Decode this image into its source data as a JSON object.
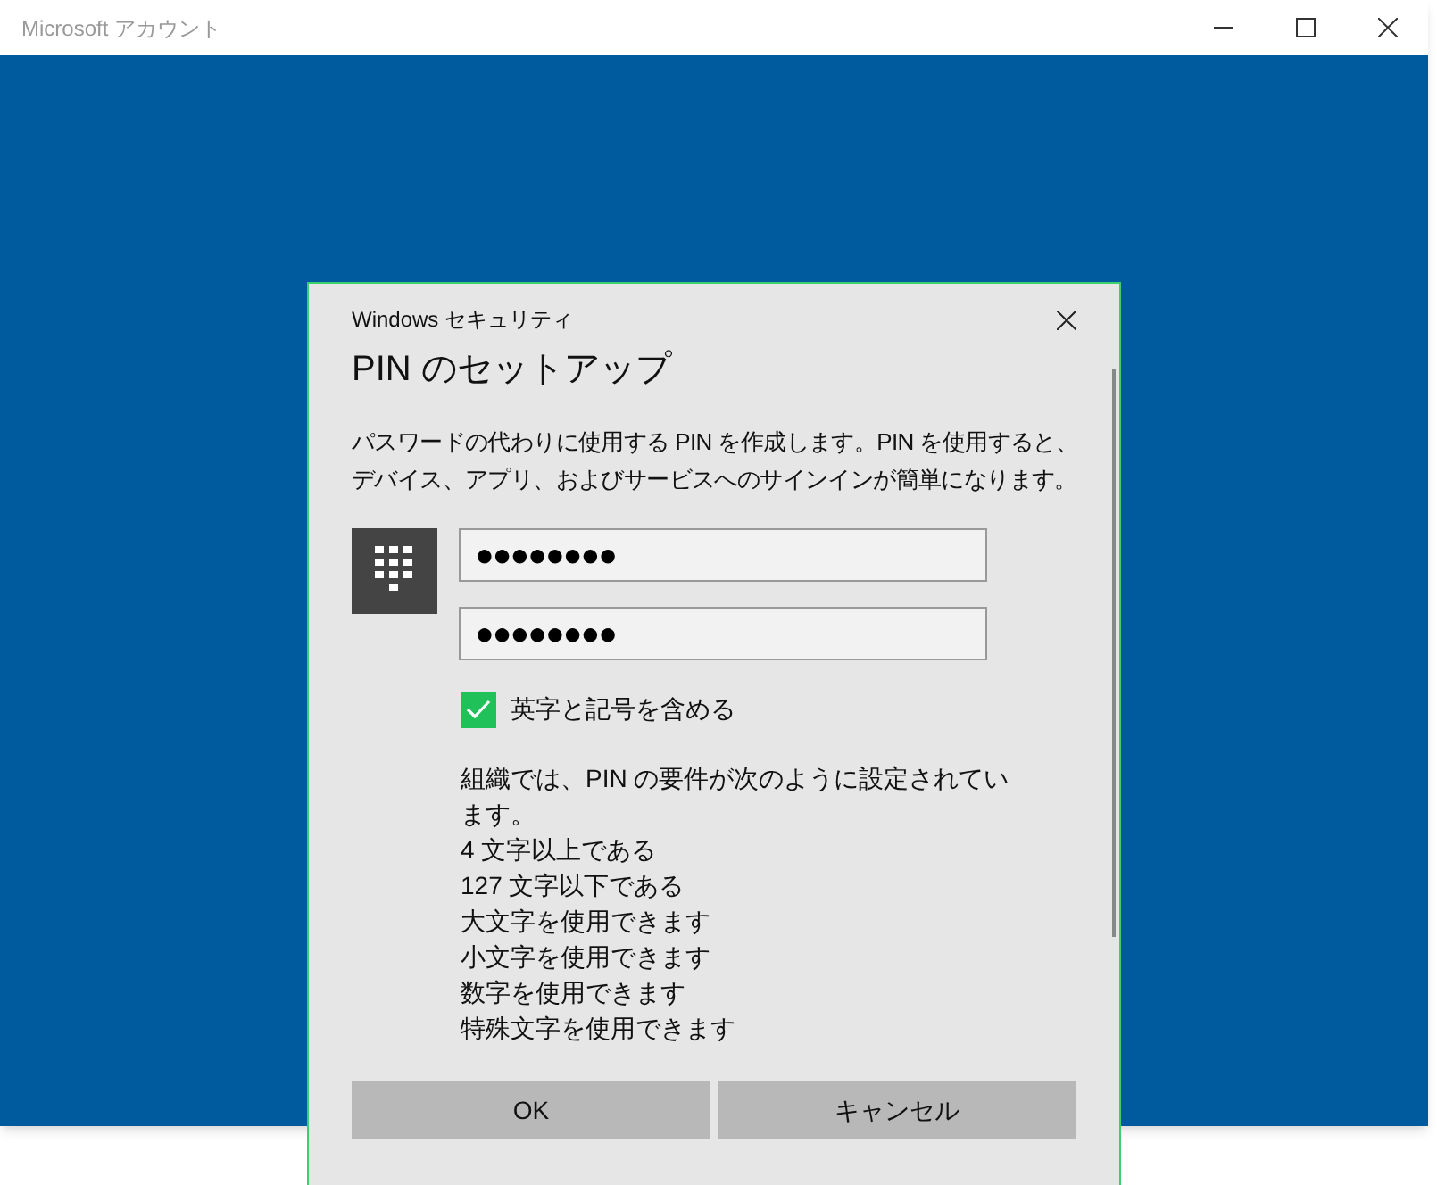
{
  "window": {
    "title": "Microsoft アカウント"
  },
  "dialog": {
    "caption": "Windows セキュリティ",
    "heading": "PIN のセットアップ",
    "description": "パスワードの代わりに使用する PIN を作成します。PIN を使用すると、デバイス、アプリ、およびサービスへのサインインが簡単になります。",
    "fields": [
      {
        "value": "●●●●●●●●"
      },
      {
        "value": "●●●●●●●●"
      }
    ],
    "checkbox": {
      "label": "英字と記号を含める",
      "checked": true
    },
    "requirements": [
      "組織では、PIN の要件が次のように設定されています。",
      "4 文字以上である",
      "127 文字以下である",
      "大文字を使用できます",
      "小文字を使用できます",
      "数字を使用できます",
      "特殊文字を使用できます"
    ],
    "buttons": [
      "OK",
      "キャンセル"
    ]
  }
}
